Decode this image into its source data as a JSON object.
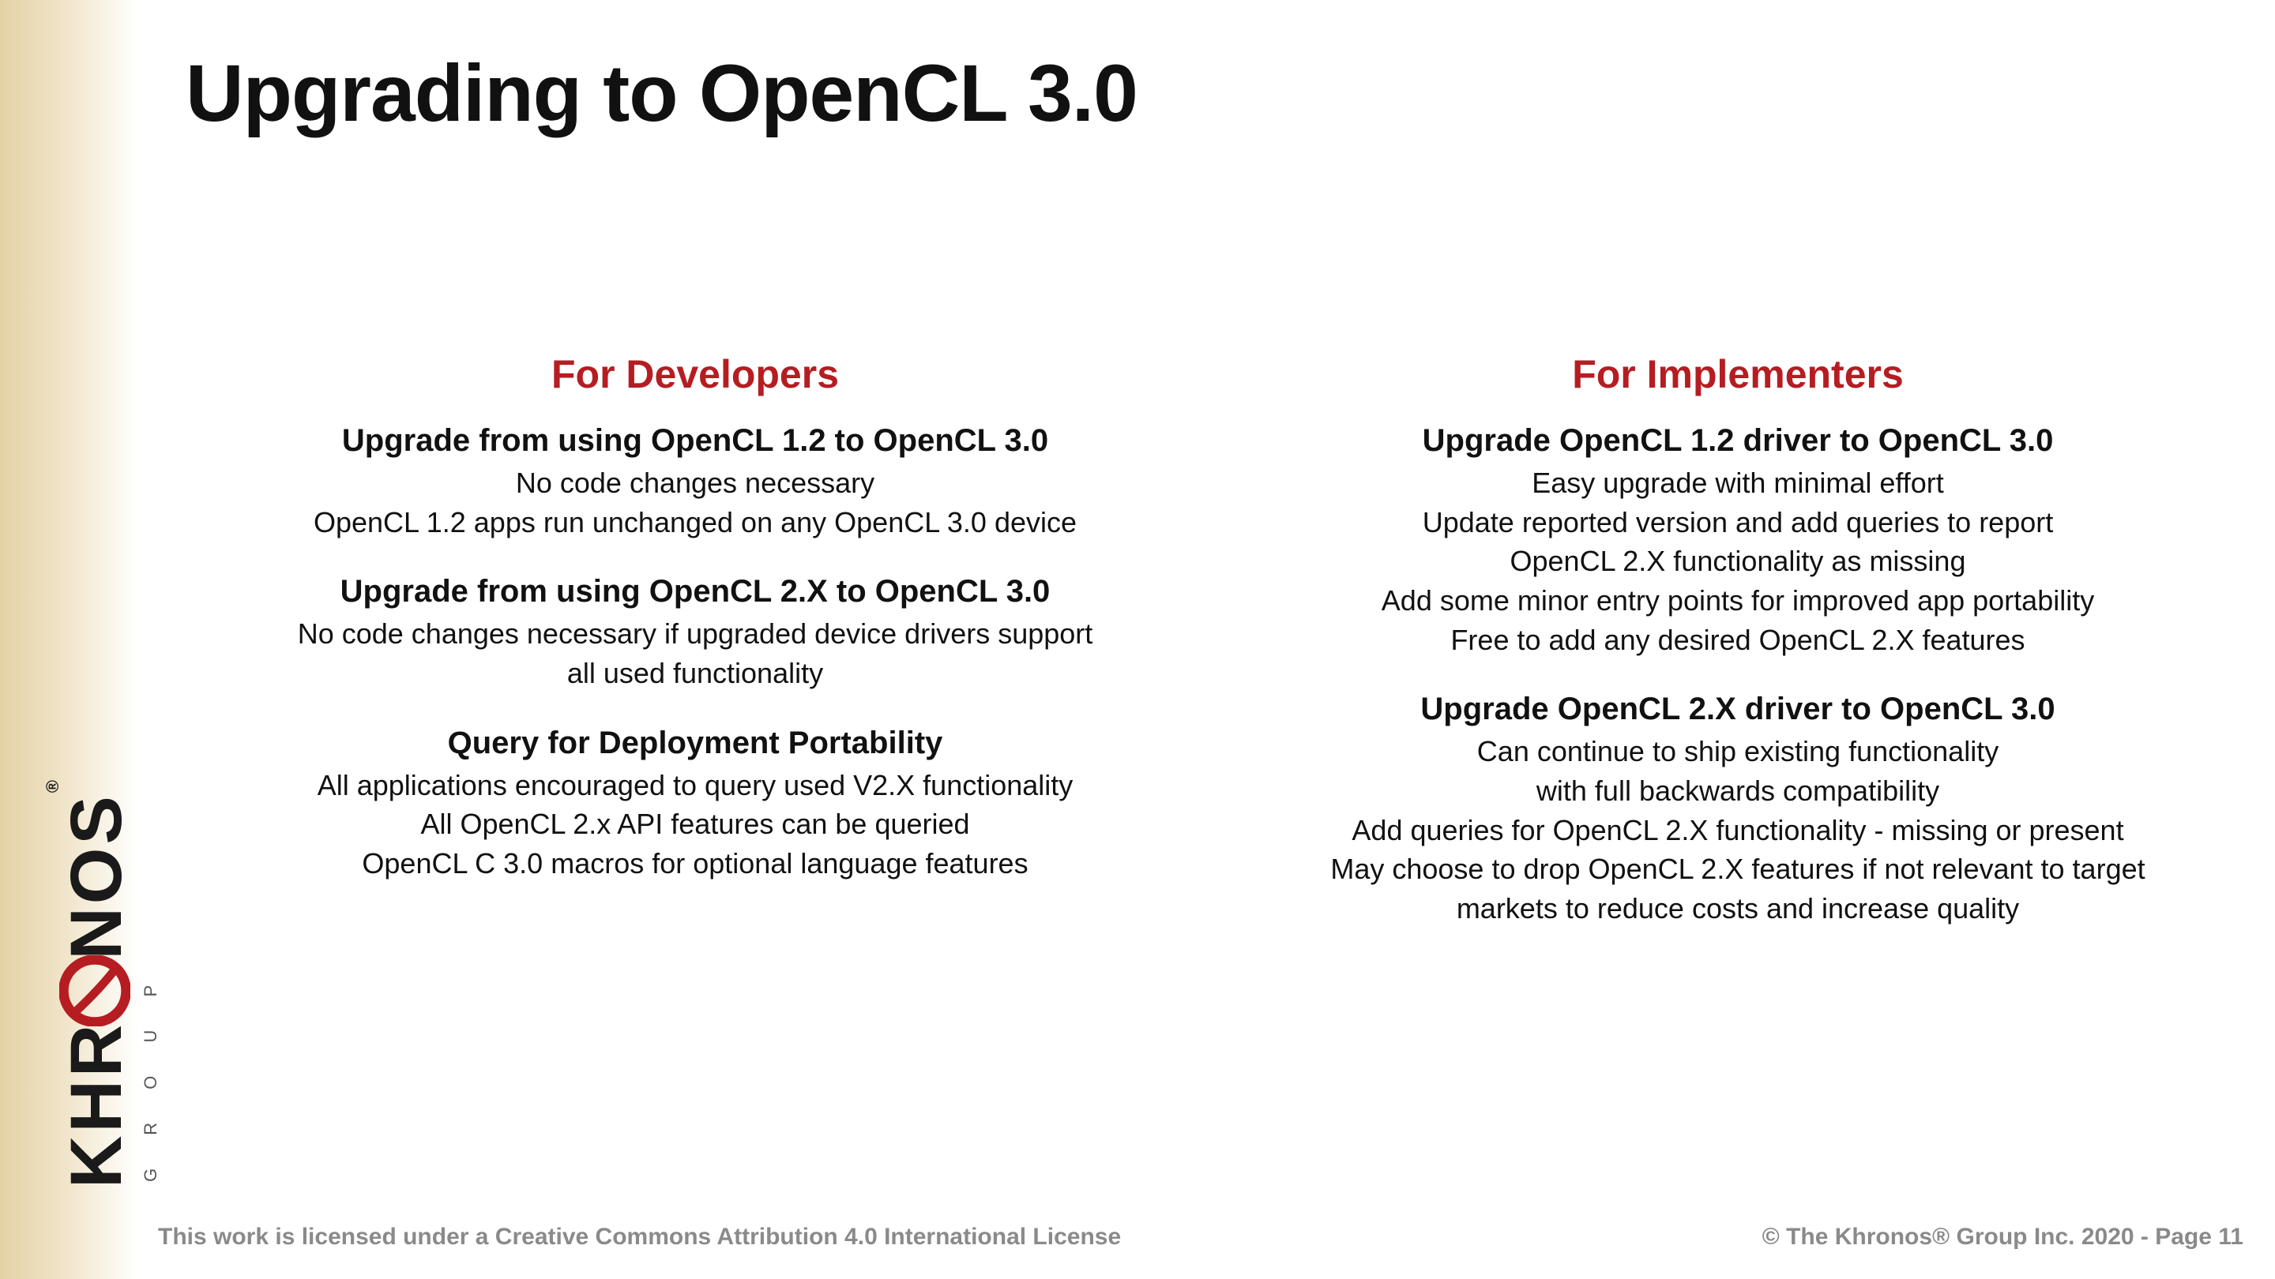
{
  "title": "Upgrading to OpenCL 3.0",
  "logo": {
    "text": "KHR",
    "o": "O",
    "tail": "NOS",
    "reg": "®",
    "sub": "G R O U P"
  },
  "columns": {
    "left": {
      "heading": "For Developers",
      "sections": [
        {
          "title": "Upgrade from using OpenCL 1.2 to OpenCL 3.0",
          "body": "No code changes necessary\nOpenCL 1.2 apps run unchanged on any OpenCL 3.0 device"
        },
        {
          "title": "Upgrade from using OpenCL 2.X to OpenCL 3.0",
          "body": "No code changes necessary if upgraded device drivers support\nall used functionality"
        },
        {
          "title": "Query for Deployment Portability",
          "body": "All applications encouraged to query used V2.X functionality\nAll OpenCL 2.x API features can be queried\nOpenCL C 3.0 macros for optional language features"
        }
      ]
    },
    "right": {
      "heading": "For Implementers",
      "sections": [
        {
          "title": "Upgrade OpenCL 1.2 driver to OpenCL 3.0",
          "body": "Easy upgrade with minimal effort\nUpdate reported version and add queries to report\nOpenCL 2.X functionality as missing\nAdd some minor entry points for improved app portability\nFree to add any desired OpenCL 2.X features"
        },
        {
          "title": "Upgrade OpenCL 2.X driver to OpenCL 3.0",
          "body": "Can continue to ship existing functionality\nwith full backwards compatibility\nAdd queries for OpenCL 2.X functionality - missing or present\nMay choose to drop OpenCL 2.X features if not relevant to target\nmarkets to reduce costs and increase quality"
        }
      ]
    }
  },
  "footer": {
    "license": "This work is licensed under a Creative Commons Attribution 4.0 International License",
    "copyright": "© The Khronos® Group Inc. 2020 - Page 11"
  }
}
